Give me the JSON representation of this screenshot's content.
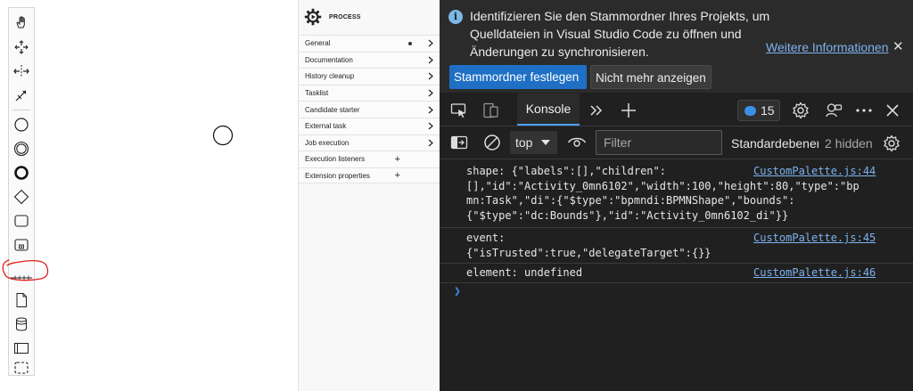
{
  "properties_panel": {
    "title": "PROCESS",
    "groups": [
      {
        "label": "General",
        "has_dot": true,
        "action": "chevron"
      },
      {
        "label": "Documentation",
        "has_dot": false,
        "action": "chevron"
      },
      {
        "label": "History cleanup",
        "has_dot": false,
        "action": "chevron"
      },
      {
        "label": "Tasklist",
        "has_dot": false,
        "action": "chevron"
      },
      {
        "label": "Candidate starter",
        "has_dot": false,
        "action": "chevron"
      },
      {
        "label": "External task",
        "has_dot": false,
        "action": "chevron"
      },
      {
        "label": "Job execution",
        "has_dot": false,
        "action": "chevron"
      },
      {
        "label": "Execution listeners",
        "has_dot": false,
        "action": "plus"
      },
      {
        "label": "Extension properties",
        "has_dot": false,
        "action": "plus"
      }
    ]
  },
  "palette": {
    "tools": [
      "hand-tool-icon",
      "lasso-tool-icon",
      "space-tool-icon",
      "global-connect-tool-icon",
      "start-event-icon",
      "intermediate-event-icon",
      "end-event-icon",
      "gateway-icon",
      "task-icon",
      "subprocess-icon",
      "custom-connection-icon",
      "data-object-icon",
      "data-store-icon",
      "participant-icon",
      "group-icon"
    ],
    "annotation_color": "#e0201b"
  },
  "devtools": {
    "infobar": {
      "message": "Identifizieren Sie den Stammordner Ihres Projekts, um Quelldateien in Visual Studio Code zu öffnen und Änderungen zu synchronisieren.",
      "link": "Weitere Informationen",
      "primary_button": "Stammordner festlegen",
      "secondary_button": "Nicht mehr anzeigen"
    },
    "tabs": {
      "console_label": "Konsole",
      "issues_count": "15"
    },
    "toolbar": {
      "context": "top",
      "filter_placeholder": "Filter",
      "levels": "Standardebenen",
      "hidden": "2 hidden"
    },
    "messages": [
      {
        "text": "shape: {\"labels\":[],\"children\":\n[],\"id\":\"Activity_0mn6102\",\"width\":100,\"height\":80,\"type\":\"bp\nmn:Task\",\"di\":{\"$type\":\"bpmndi:BPMNShape\",\"bounds\":\n{\"$type\":\"dc:Bounds\"},\"id\":\"Activity_0mn6102_di\"}}",
        "source": "CustomPalette.js:44"
      },
      {
        "text": "event:\n{\"isTrusted\":true,\"delegateTarget\":{}}",
        "source": "CustomPalette.js:45"
      },
      {
        "text": "element: undefined",
        "source": "CustomPalette.js:46"
      }
    ],
    "accent_color": "#4aa3ff"
  }
}
